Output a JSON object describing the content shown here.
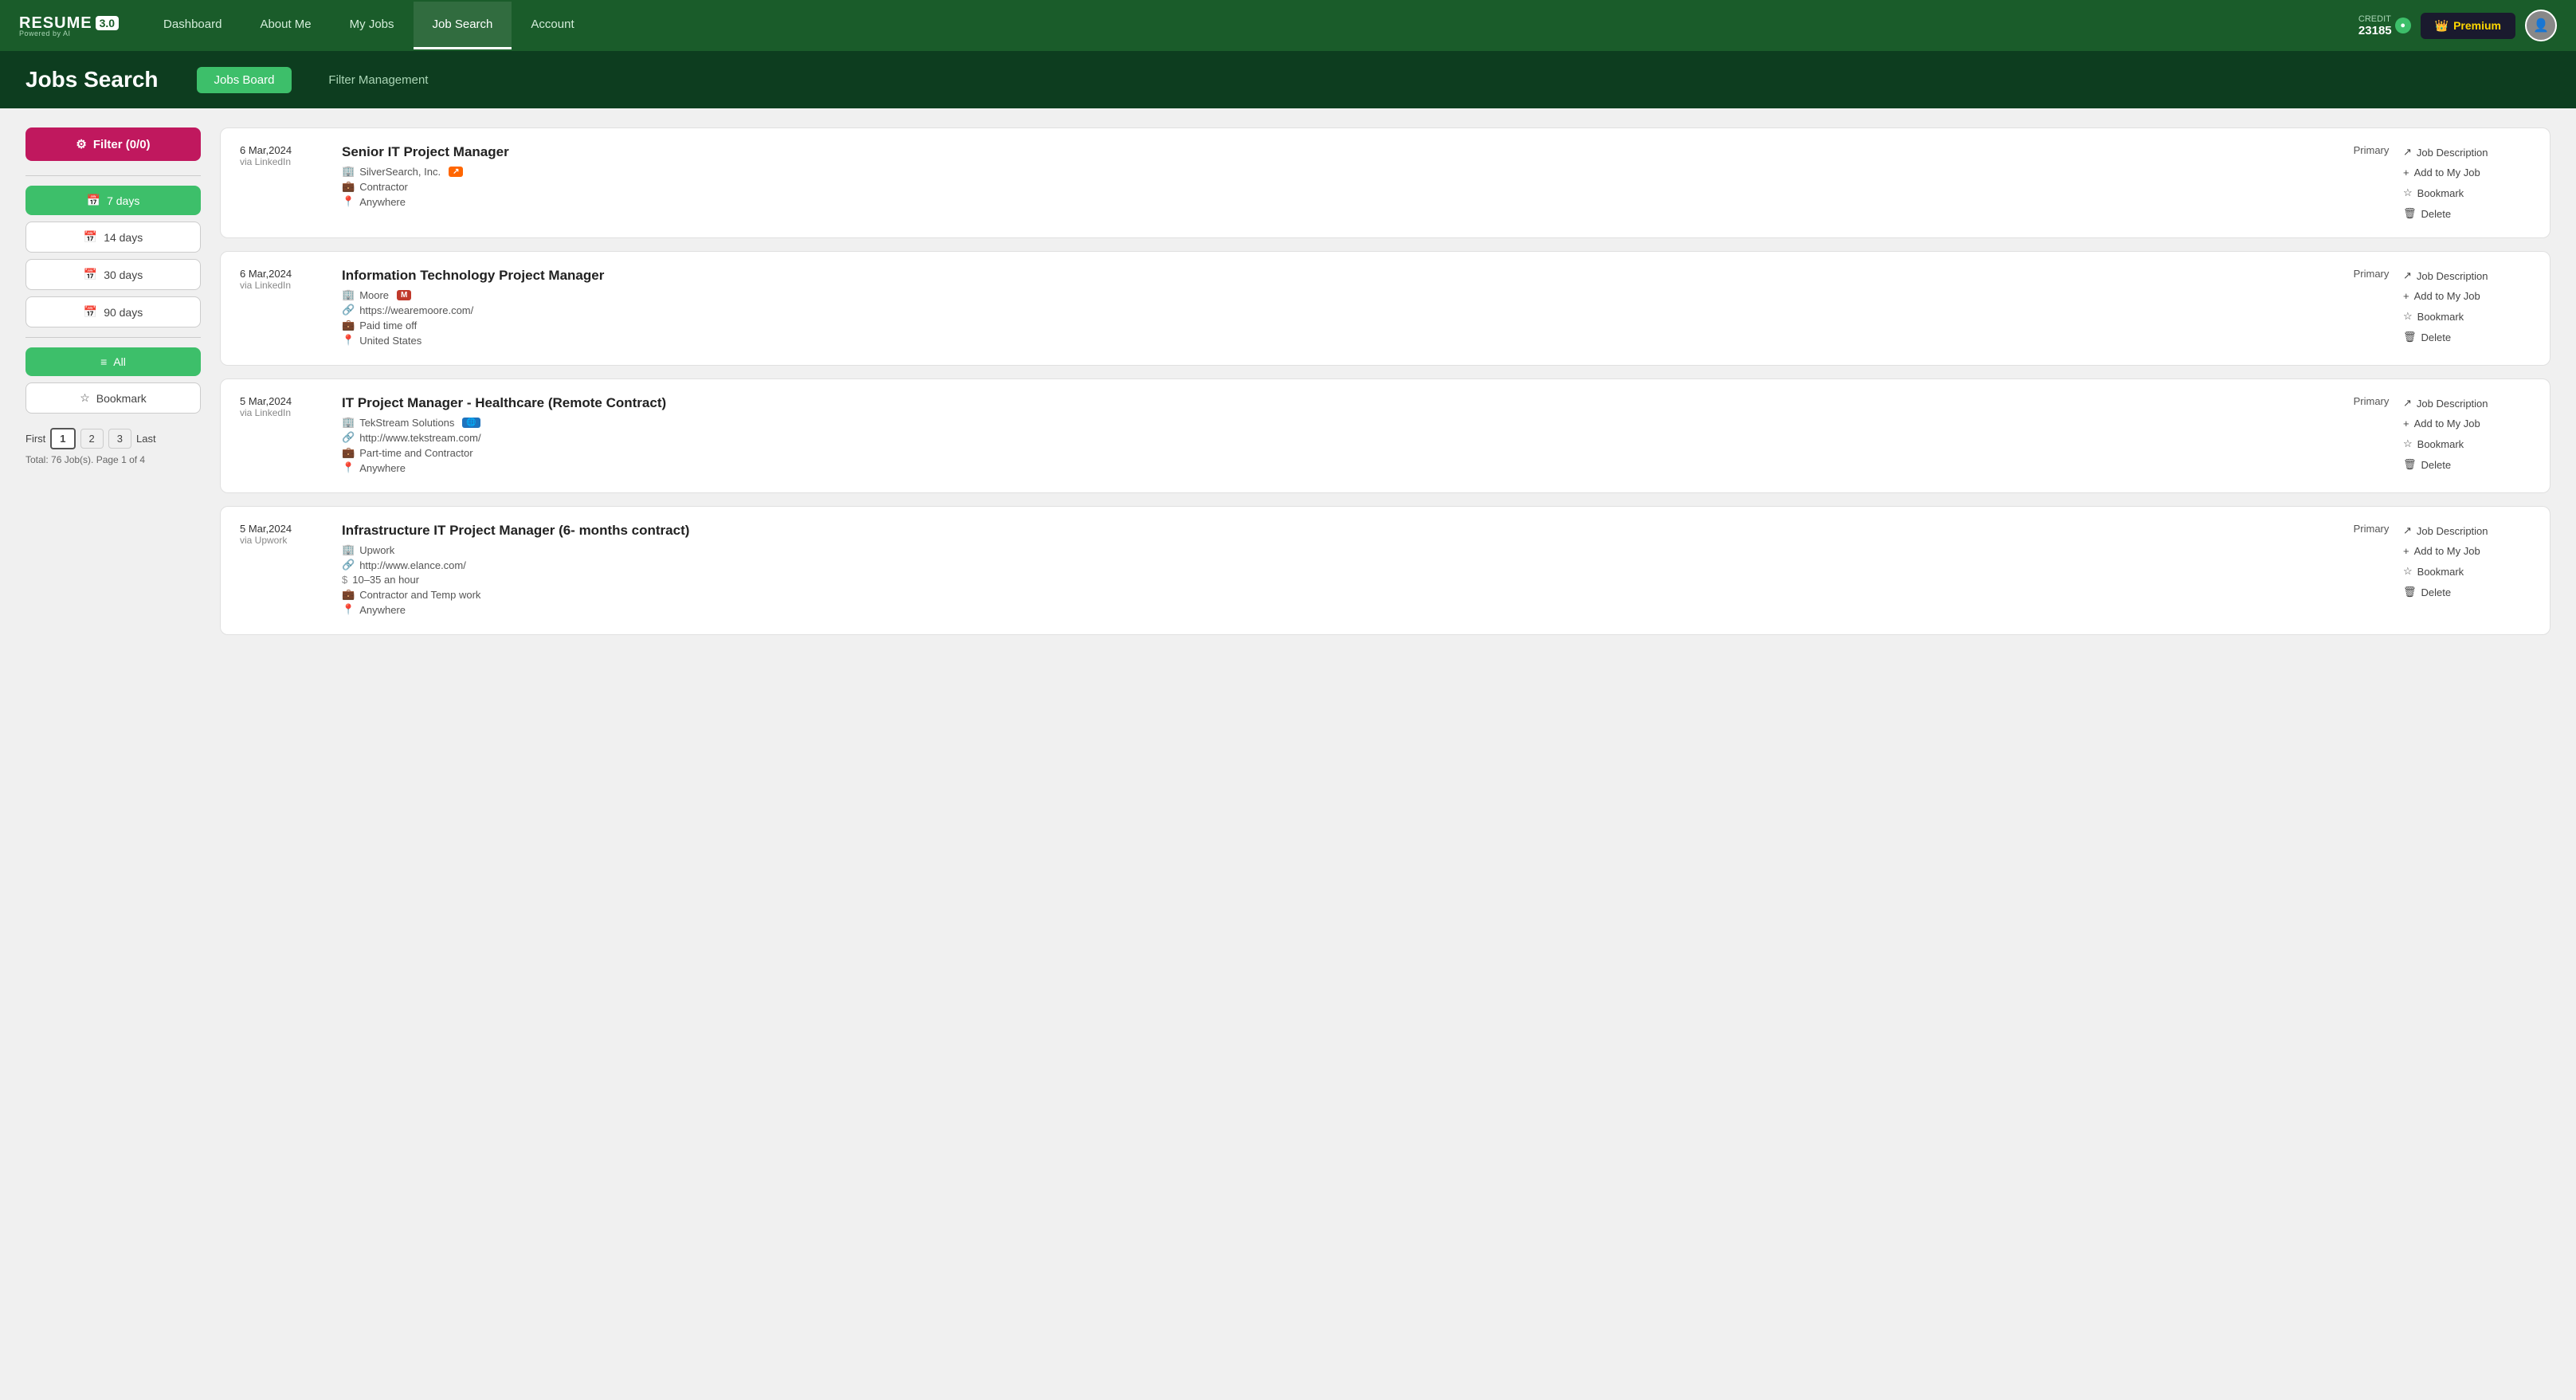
{
  "app": {
    "name": "RESUME",
    "version": "3.0",
    "powered_by": "Powered by AI"
  },
  "nav": {
    "links": [
      {
        "id": "dashboard",
        "label": "Dashboard",
        "active": false
      },
      {
        "id": "about-me",
        "label": "About Me",
        "active": false
      },
      {
        "id": "my-jobs",
        "label": "My Jobs",
        "active": false
      },
      {
        "id": "job-search",
        "label": "Job Search",
        "active": true
      },
      {
        "id": "account",
        "label": "Account",
        "active": false
      }
    ],
    "credit": {
      "label": "CREDIT",
      "value": "23185"
    },
    "premium_label": "Premium"
  },
  "header": {
    "title": "Jobs Search",
    "tabs": [
      {
        "id": "jobs-board",
        "label": "Jobs Board",
        "active": true
      },
      {
        "id": "filter-management",
        "label": "Filter Management",
        "active": false
      }
    ]
  },
  "sidebar": {
    "filter_btn": "Filter (0/0)",
    "day_filters": [
      {
        "id": "7days",
        "label": "7 days",
        "active": true
      },
      {
        "id": "14days",
        "label": "14 days",
        "active": false
      },
      {
        "id": "30days",
        "label": "30 days",
        "active": false
      },
      {
        "id": "90days",
        "label": "90 days",
        "active": false
      }
    ],
    "view_filters": [
      {
        "id": "all",
        "label": "All",
        "active": true
      },
      {
        "id": "bookmark",
        "label": "Bookmark",
        "active": false
      }
    ],
    "pagination": {
      "first": "First",
      "pages": [
        "1",
        "2",
        "3"
      ],
      "current": "1",
      "last": "Last"
    },
    "pagination_info": "Total: 76 Job(s). Page 1 of 4"
  },
  "jobs": [
    {
      "id": "job1",
      "date": "6 Mar,2024",
      "via": "via LinkedIn",
      "title": "Senior IT Project Manager",
      "company": "SilverSearch, Inc.",
      "company_badge": "",
      "website": "",
      "job_type": "Contractor",
      "location": "Anywhere",
      "badge_text": "",
      "badge_color": "orange",
      "type_label": "Primary",
      "actions": [
        {
          "id": "job-desc",
          "icon": "↗",
          "label": "Job Description"
        },
        {
          "id": "add-job",
          "icon": "+",
          "label": "Add to My Job"
        },
        {
          "id": "bookmark",
          "icon": "☆",
          "label": "Bookmark"
        },
        {
          "id": "delete",
          "icon": "🗑",
          "label": "Delete"
        }
      ]
    },
    {
      "id": "job2",
      "date": "6 Mar,2024",
      "via": "via LinkedIn",
      "title": "Information Technology Project Manager",
      "company": "Moore",
      "company_badge": "M",
      "website": "https://wearemoore.com/",
      "job_type": "Paid time off",
      "location": "United States",
      "badge_text": "M",
      "badge_color": "red",
      "type_label": "Primary",
      "actions": [
        {
          "id": "job-desc",
          "icon": "↗",
          "label": "Job Description"
        },
        {
          "id": "add-job",
          "icon": "+",
          "label": "Add to My Job"
        },
        {
          "id": "bookmark",
          "icon": "☆",
          "label": "Bookmark"
        },
        {
          "id": "delete",
          "icon": "🗑",
          "label": "Delete"
        }
      ]
    },
    {
      "id": "job3",
      "date": "5 Mar,2024",
      "via": "via LinkedIn",
      "title": "IT Project Manager - Healthcare (Remote Contract)",
      "company": "TekStream Solutions",
      "company_badge": "🌐",
      "website": "http://www.tekstream.com/",
      "job_type": "Part-time and Contractor",
      "location": "Anywhere",
      "badge_text": "globe",
      "badge_color": "blue",
      "type_label": "Primary",
      "actions": [
        {
          "id": "job-desc",
          "icon": "↗",
          "label": "Job Description"
        },
        {
          "id": "add-job",
          "icon": "+",
          "label": "Add to My Job"
        },
        {
          "id": "bookmark",
          "icon": "☆",
          "label": "Bookmark"
        },
        {
          "id": "delete",
          "icon": "🗑",
          "label": "Delete"
        }
      ]
    },
    {
      "id": "job4",
      "date": "5 Mar,2024",
      "via": "via Upwork",
      "title": "Infrastructure IT Project Manager (6- months contract)",
      "company": "Upwork",
      "company_badge": "",
      "website": "http://www.elance.com/",
      "job_type": "Contractor and Temp work",
      "salary": "10–35 an hour",
      "location": "Anywhere",
      "badge_text": "",
      "badge_color": "",
      "type_label": "Primary",
      "actions": [
        {
          "id": "job-desc",
          "icon": "↗",
          "label": "Job Description"
        },
        {
          "id": "add-job",
          "icon": "+",
          "label": "Add to My Job"
        },
        {
          "id": "bookmark",
          "icon": "☆",
          "label": "Bookmark"
        },
        {
          "id": "delete",
          "icon": "🗑",
          "label": "Delete"
        }
      ]
    }
  ]
}
